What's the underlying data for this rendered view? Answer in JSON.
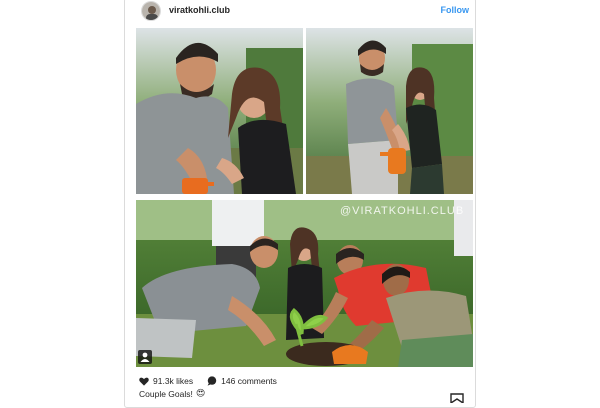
{
  "post": {
    "username": "viratkohli.club",
    "follow_label": "Follow",
    "watermark": "@VIRATKOHLI.CLUB",
    "likes": "91.3k likes",
    "comments": "146 comments",
    "caption": "Couple Goals!",
    "caption_emoji": "😍"
  },
  "icons": {
    "avatar": "avatar-image",
    "heart": "heart-icon",
    "comment": "comment-bubble-icon",
    "person": "person-icon",
    "bookmark": "bookmark-icon"
  },
  "colors": {
    "follow": "#3897f0",
    "text": "#262626",
    "border": "#dbdbdb"
  }
}
